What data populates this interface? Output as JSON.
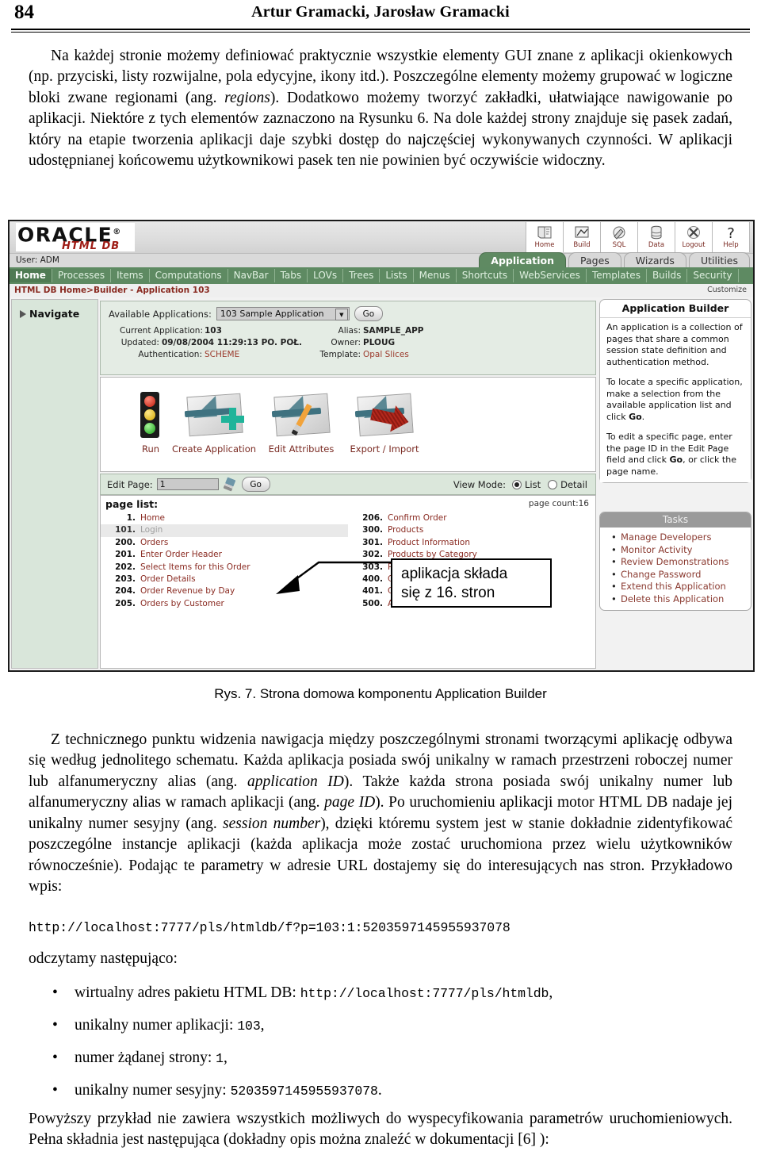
{
  "page": {
    "folio": "84",
    "running_title": "Artur Gramacki, Jarosław Gramacki"
  },
  "intro_paragraph": {
    "seg1": "Na każdej stronie możemy definiować praktycznie wszystkie elementy GUI znane z aplikacji okienkowych (np. przyciski, listy rozwijalne, pola edycyjne, ikony itd.). Poszczególne elementy możemy grupować w logiczne bloki zwane regionami (ang. ",
    "it1": "regions",
    "seg2": "). Dodatkowo możemy tworzyć zakładki, ułatwiające nawigowanie po aplikacji. Niektóre z tych elementów zaznaczono na Rysunku 6. Na dole każdej strony znajduje się pasek zadań, który na etapie tworzenia aplikacji daje szybki dostęp do najczęściej wykonywanych czynności. W aplikacji udostępnianej końcowemu użytkownikowi pasek ten nie powinien być oczywiście widoczny."
  },
  "figure": {
    "caption": "Rys. 7. Strona domowa komponentu Application Builder",
    "callout": {
      "line1": "aplikacja składa",
      "line2": "się z 16. stron"
    },
    "screenshot": {
      "logo": {
        "brand": "ORACLE",
        "registered": "®",
        "product": "HTML DB"
      },
      "user_bar": "User: ADM",
      "global_icons": [
        {
          "label": "Home",
          "icon": "home-book-icon"
        },
        {
          "label": "Build",
          "icon": "build-chart-icon"
        },
        {
          "label": "SQL",
          "icon": "sql-brush-icon"
        },
        {
          "label": "Data",
          "icon": "database-icon"
        },
        {
          "label": "Logout",
          "icon": "logout-x-icon"
        },
        {
          "label": "Help",
          "icon": "help-question-icon"
        }
      ],
      "app_tabs": [
        {
          "label": "Application",
          "selected": true
        },
        {
          "label": "Pages",
          "selected": false
        },
        {
          "label": "Wizards",
          "selected": false
        },
        {
          "label": "Utilities",
          "selected": false
        }
      ],
      "nav_tabs": [
        {
          "label": "Home",
          "selected": true
        },
        {
          "label": "Processes",
          "selected": false
        },
        {
          "label": "Items",
          "selected": false
        },
        {
          "label": "Computations",
          "selected": false
        },
        {
          "label": "NavBar",
          "selected": false
        },
        {
          "label": "Tabs",
          "selected": false
        },
        {
          "label": "LOVs",
          "selected": false
        },
        {
          "label": "Trees",
          "selected": false
        },
        {
          "label": "Lists",
          "selected": false
        },
        {
          "label": "Menus",
          "selected": false
        },
        {
          "label": "Shortcuts",
          "selected": false
        },
        {
          "label": "WebServices",
          "selected": false
        },
        {
          "label": "Templates",
          "selected": false
        },
        {
          "label": "Builds",
          "selected": false
        },
        {
          "label": "Security",
          "selected": false
        }
      ],
      "breadcrumb": "HTML DB Home>Builder - Application 103",
      "customize_link": "Customize",
      "navigate_label": "Navigate",
      "available_applications": {
        "label": "Available Applications:",
        "selected": "103 Sample Application",
        "go_button": "Go"
      },
      "app_meta_left": [
        {
          "key": "Current Application:",
          "value": "103",
          "red": false
        },
        {
          "key": "Updated:",
          "value": "09/08/2004 11:29:13 PO. POŁ.",
          "red": false
        },
        {
          "key": "Authentication:",
          "value": "SCHEME",
          "red": true
        }
      ],
      "app_meta_right": [
        {
          "key": "Alias:",
          "value": "SAMPLE_APP",
          "red": false
        },
        {
          "key": "Owner:",
          "value": "PLOUG",
          "red": false
        },
        {
          "key": "Template:",
          "value": "Opal Slices",
          "red": true
        }
      ],
      "big_icons": [
        {
          "label": "Run",
          "icon": "traffic-light-icon"
        },
        {
          "label": "Create Application",
          "icon": "drafting-plus-icon"
        },
        {
          "label": "Edit Attributes",
          "icon": "drafting-pencil-icon"
        },
        {
          "label": "Export / Import",
          "icon": "export-arrow-icon"
        }
      ],
      "edit_page": {
        "label": "Edit Page:",
        "value": "1",
        "brush_icon": "brush-icon",
        "go_button": "Go",
        "view_mode_label": "View Mode:",
        "view_modes": [
          {
            "label": "List",
            "selected": true
          },
          {
            "label": "Detail",
            "selected": false
          }
        ]
      },
      "page_list": {
        "heading": "page list:",
        "count_label": "page count:16",
        "column_left": [
          {
            "num": "1.",
            "name": "Home",
            "dim": false
          },
          {
            "num": "101.",
            "name": "Login",
            "dim": true
          },
          {
            "num": "200.",
            "name": "Orders",
            "dim": false
          },
          {
            "num": "201.",
            "name": "Enter Order Header",
            "dim": false
          },
          {
            "num": "202.",
            "name": "Select Items for this Order",
            "dim": false
          },
          {
            "num": "203.",
            "name": "Order Details",
            "dim": false
          },
          {
            "num": "204.",
            "name": "Order Revenue by Day",
            "dim": false
          },
          {
            "num": "205.",
            "name": "Orders by Customer",
            "dim": false
          }
        ],
        "column_right": [
          {
            "num": "206.",
            "name": "Confirm Order",
            "dim": false
          },
          {
            "num": "300.",
            "name": "Products",
            "dim": false
          },
          {
            "num": "301.",
            "name": "Product Information",
            "dim": false
          },
          {
            "num": "302.",
            "name": "Products by Category",
            "dim": false
          },
          {
            "num": "303.",
            "name": "Products in Category \"&P303_CATE",
            "dim": false
          },
          {
            "num": "400.",
            "name": "Customers",
            "dim": false
          },
          {
            "num": "401.",
            "name": "Customer Information",
            "dim": false
          },
          {
            "num": "500.",
            "name": "About",
            "dim": false
          }
        ]
      },
      "help_panel": {
        "title": "Application Builder",
        "p1": "An application is a collection of pages that share a common session state definition and authentication method.",
        "p2_a": "To locate a specific application, make a selection from the available application list and click ",
        "p2_b": "Go",
        "p2_c": ".",
        "p3_a": "To edit a specific page, enter the page ID in the Edit Page field and click ",
        "p3_b": "Go",
        "p3_c": ", or click the page name."
      },
      "tasks_panel": {
        "title": "Tasks",
        "items": [
          "Manage Developers",
          "Monitor Activity",
          "Review Demonstrations",
          "Change Password",
          "Extend this Application",
          "Delete this Application"
        ]
      }
    }
  },
  "body_after": {
    "p1_a": "Z technicznego punktu widzenia nawigacja między poszczególnymi stronami tworzącymi aplikację odbywa się według jednolitego schematu. Każda aplikacja posiada swój unikalny w ramach przestrzeni roboczej numer lub alfanumeryczny alias (ang. ",
    "p1_it1": "application ID",
    "p1_b": "). Także każda strona posiada swój unikalny numer lub alfanumeryczny alias w ramach aplikacji (ang. ",
    "p1_it2": "page ID",
    "p1_c": "). Po uruchomieniu aplikacji motor HTML DB nadaje jej unikalny numer sesyjny (ang. ",
    "p1_it3": "session number",
    "p1_d": "), dzięki któremu system jest w stanie dokładnie zidentyfikować poszczególne instancje aplikacji (każda aplikacja może zostać uruchomiona przez wielu użytkowników równocześnie). Podając te parametry w adresie URL dostajemy się do interesujących nas stron. Przykładowo wpis:",
    "url_example": "http://localhost:7777/pls/htmldb/f?p=103:1:5203597145955937078",
    "read_as": "odczytamy następująco:",
    "bullets": [
      {
        "text": "wirtualny adres pakietu HTML DB: ",
        "mono": "http://localhost:7777/pls/htmldb",
        "tail": ","
      },
      {
        "text": "unikalny numer aplikacji: ",
        "mono": "103",
        "tail": ","
      },
      {
        "text": "numer żądanej strony: ",
        "mono": "1",
        "tail": ","
      },
      {
        "text": "unikalny numer sesyjny: ",
        "mono": "5203597145955937078",
        "tail": "."
      }
    ],
    "closing": "Powyższy przykład nie zawiera wszystkich możliwych do wyspecyfikowania parametrów uruchomieniowych. Pełna składnia jest następująca (dokładny opis można znaleźć w dokumentacji [6] ):"
  }
}
